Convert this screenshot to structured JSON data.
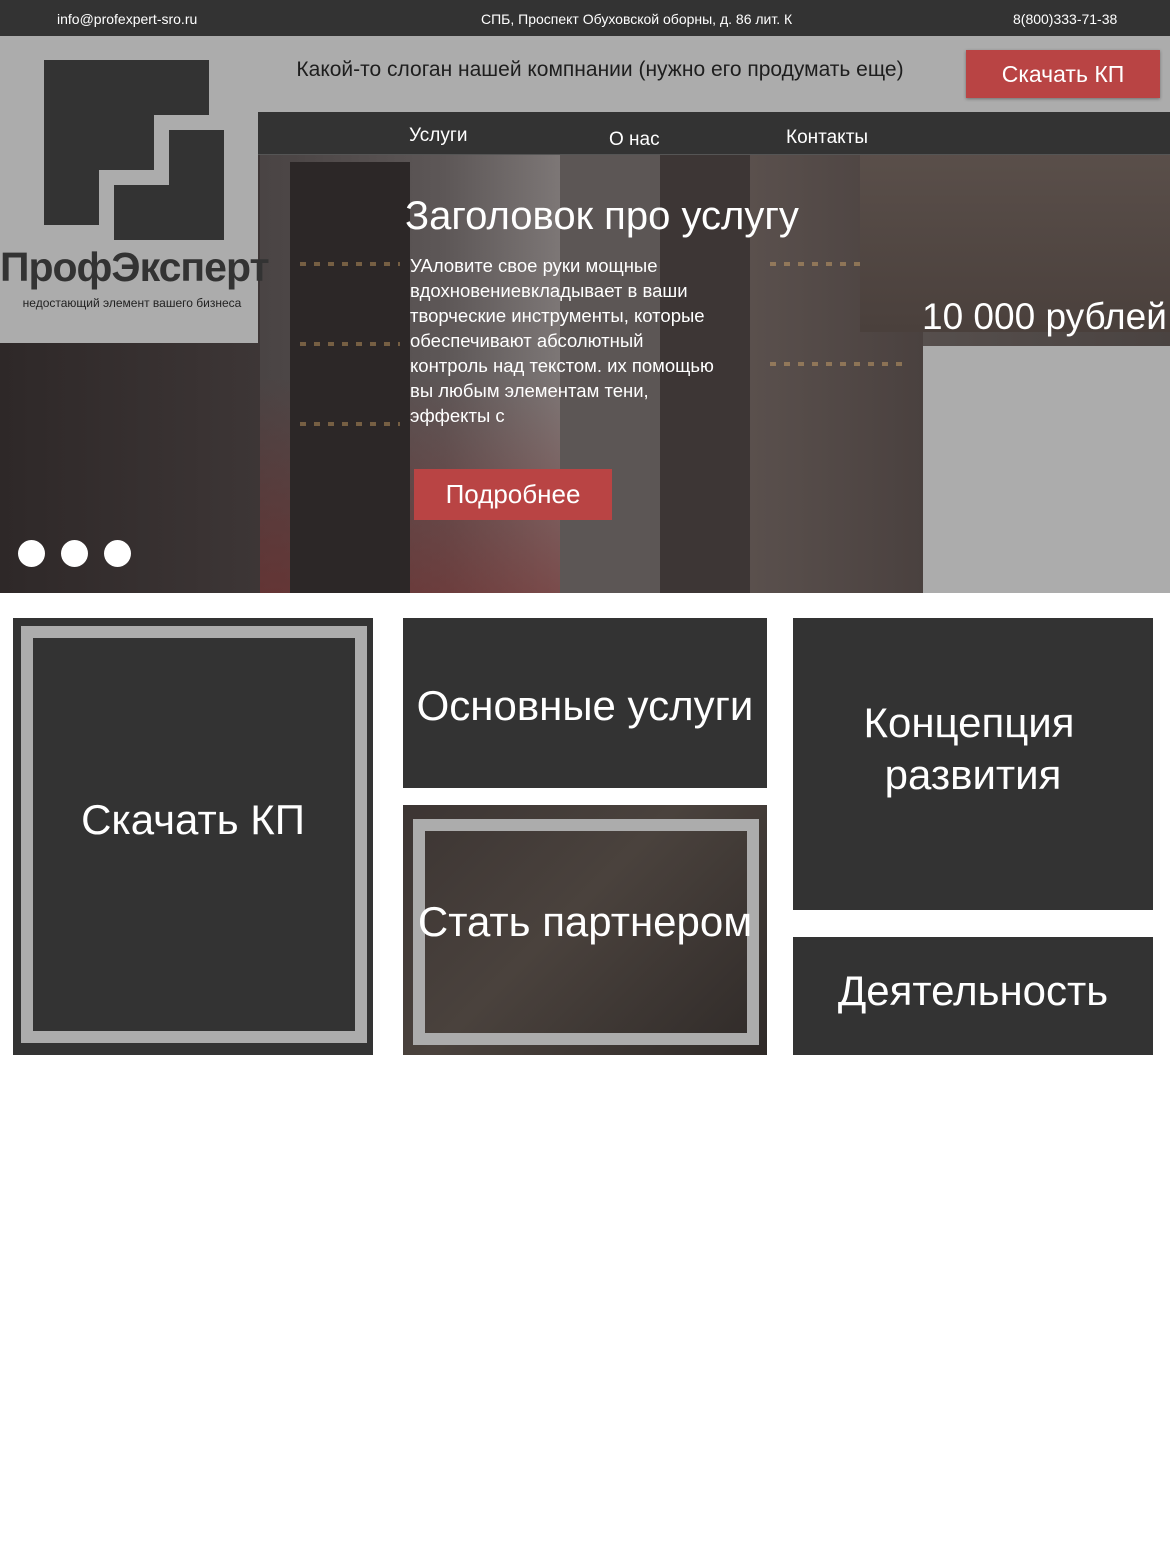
{
  "topbar": {
    "email": "info@profexpert-sro.ru",
    "address": "СПБ, Проспект Обуховской оборны, д. 86 лит. К",
    "phone": "8(800)333-71-38"
  },
  "header": {
    "slogan": "Какой-то слоган нашей компнании (нужно его продумать еще)",
    "download_button": "Скачать КП"
  },
  "logo": {
    "title": "ПрофЭксперт",
    "subtitle": "недостающий элемент вашего бизнеса"
  },
  "nav": {
    "items": [
      "Услуги",
      "О нас",
      "Контакты"
    ]
  },
  "hero": {
    "title": "Заголовок про услугу",
    "text": " УАловите свое руки мощные вдохновениевкладывает в ваши творческие инструменты, которые обеспечивают абсолютный контроль над текстом. их помощью вы любым элементам тени,  эффекты с",
    "button": "Подробнее",
    "price": "10 000 рублей",
    "slides": 3
  },
  "tiles": {
    "download": "Скачать КП",
    "services": "Основные услуги",
    "partner": "Стать партнером",
    "concept_line1": "Концепция",
    "concept_line2": "развития",
    "activity": "Деятельность"
  },
  "colors": {
    "dark": "#333333",
    "gray": "#acacac",
    "accent": "#b94444"
  }
}
